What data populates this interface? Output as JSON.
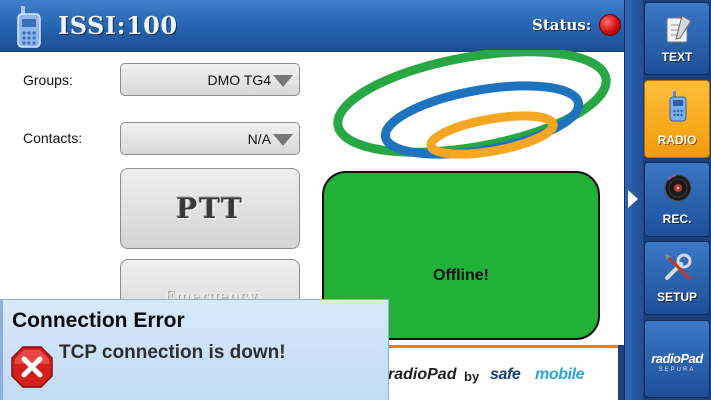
{
  "header": {
    "title": "ISSI:100",
    "status_label": "Status:",
    "status_color": "#d10f0f"
  },
  "form": {
    "groups_label": "Groups:",
    "groups_value": "DMO TG4",
    "contacts_label": "Contacts:",
    "contacts_value": "N/A"
  },
  "buttons": {
    "ptt_label": "PTT",
    "emergency_label": "Emergency"
  },
  "status_panel": {
    "text": "Offline!",
    "color": "#22b039"
  },
  "sidebar": {
    "items": [
      {
        "label": "TEXT",
        "icon": "notepad-icon",
        "active": false
      },
      {
        "label": "RADIO",
        "icon": "radio-icon",
        "active": true
      },
      {
        "label": "REC.",
        "icon": "disc-icon",
        "active": false
      },
      {
        "label": "SETUP",
        "icon": "tools-icon",
        "active": false
      }
    ],
    "brand": "radioPad",
    "brand_sub": "SEPURA"
  },
  "footer": {
    "product": "radioPad",
    "by": "by",
    "company_part1": "safe",
    "company_part2": "mobile",
    "accent_color": "#e77d1c"
  },
  "error_dialog": {
    "title": "Connection Error",
    "message": "TCP connection is down!",
    "icon": "error-icon"
  },
  "colors": {
    "header_blue": "#2563b0",
    "active_orange": "#f29b0c",
    "logo_green": "#27a844",
    "logo_blue": "#1e73be",
    "logo_orange": "#f5a623"
  }
}
